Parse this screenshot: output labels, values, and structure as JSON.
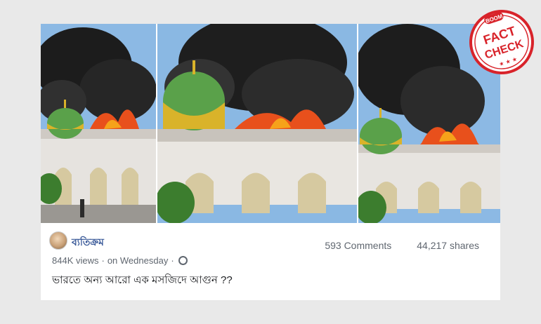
{
  "post": {
    "author": "ব্যতিক্রম",
    "views": "844K views",
    "separator": "·",
    "date": "on Wednesday",
    "separator2": "·",
    "comments": "593 Comments",
    "shares": "44,217 shares",
    "caption": "ভারতে অন্য আরো এক মসজিদে আগুন ??"
  },
  "stamp": {
    "brand": "BOOM",
    "line1": "FACT",
    "line2": "CHECK",
    "stars": "★ ★ ★",
    "color": "#d8232a"
  },
  "icons": {
    "privacy": "globe-icon"
  }
}
